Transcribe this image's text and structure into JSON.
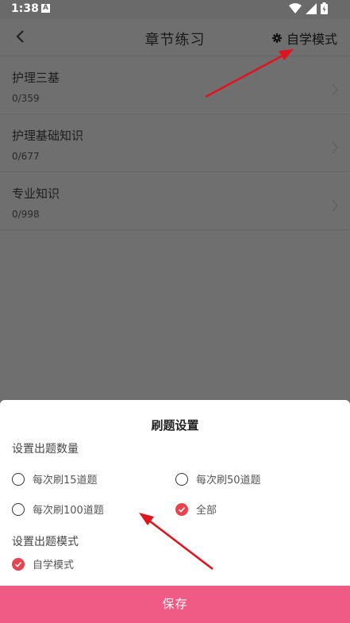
{
  "status_bar": {
    "time": "1:38",
    "notification_icon": "A"
  },
  "app_bar": {
    "title": "章节练习",
    "mode_label": "自学模式"
  },
  "chapters": [
    {
      "name": "护理三基",
      "progress": "0/359"
    },
    {
      "name": "护理基础知识",
      "progress": "0/677"
    },
    {
      "name": "专业知识",
      "progress": "0/998"
    }
  ],
  "sheet": {
    "title": "刷题设置",
    "quantity_label": "设置出题数量",
    "options": {
      "opt15": "每次刷15道题",
      "opt50": "每次刷50道题",
      "opt100": "每次刷100道题",
      "all": "全部"
    },
    "selected_quantity": "全部",
    "mode_section_label": "设置出题模式",
    "mode_option": "自学模式",
    "save_label": "保存"
  },
  "colors": {
    "accent": "#e8434f",
    "save_button": "#f05b85",
    "annotation_arrow": "#e0141e"
  }
}
